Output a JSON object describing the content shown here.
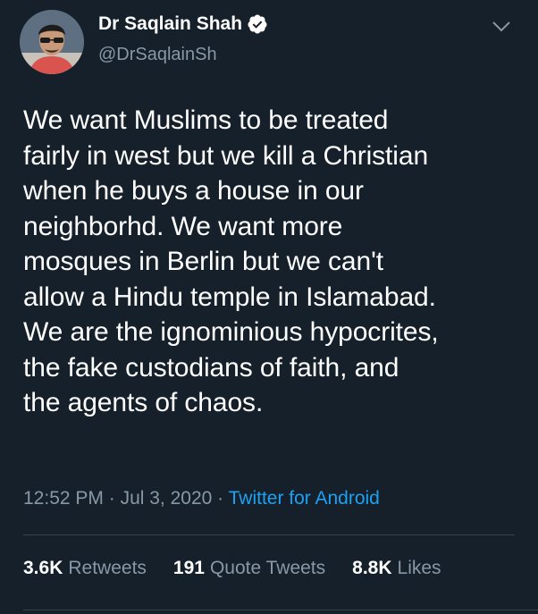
{
  "author": {
    "display_name": "Dr Saqlain Shah",
    "handle": "@DrSaqlainSh",
    "verified": true,
    "avatar_icon": "profile-photo"
  },
  "tweet": {
    "text": "We want Muslims to be treated\nfairly  in west but we kill a Christian\nwhen he buys a house in our\nneighborhd. We want more\nmosques in Berlin but we can't\nallow a Hindu temple in Islamabad.\nWe are the ignominious hypocrites,\nthe fake custodians of faith, and\nthe agents of chaos.",
    "time": "12:52 PM",
    "date": "Jul 3, 2020",
    "separator": "·",
    "source": "Twitter for Android"
  },
  "stats": {
    "retweets_count": "3.6K",
    "retweets_label": "Retweets",
    "quotes_count": "191",
    "quotes_label": "Quote Tweets",
    "likes_count": "8.8K",
    "likes_label": "Likes"
  },
  "colors": {
    "background": "#15202b",
    "secondary_text": "#8899a6",
    "link": "#1da1f2",
    "divider": "#38444d"
  },
  "icons": {
    "verified": "verified-badge-icon",
    "menu": "chevron-down-icon"
  }
}
